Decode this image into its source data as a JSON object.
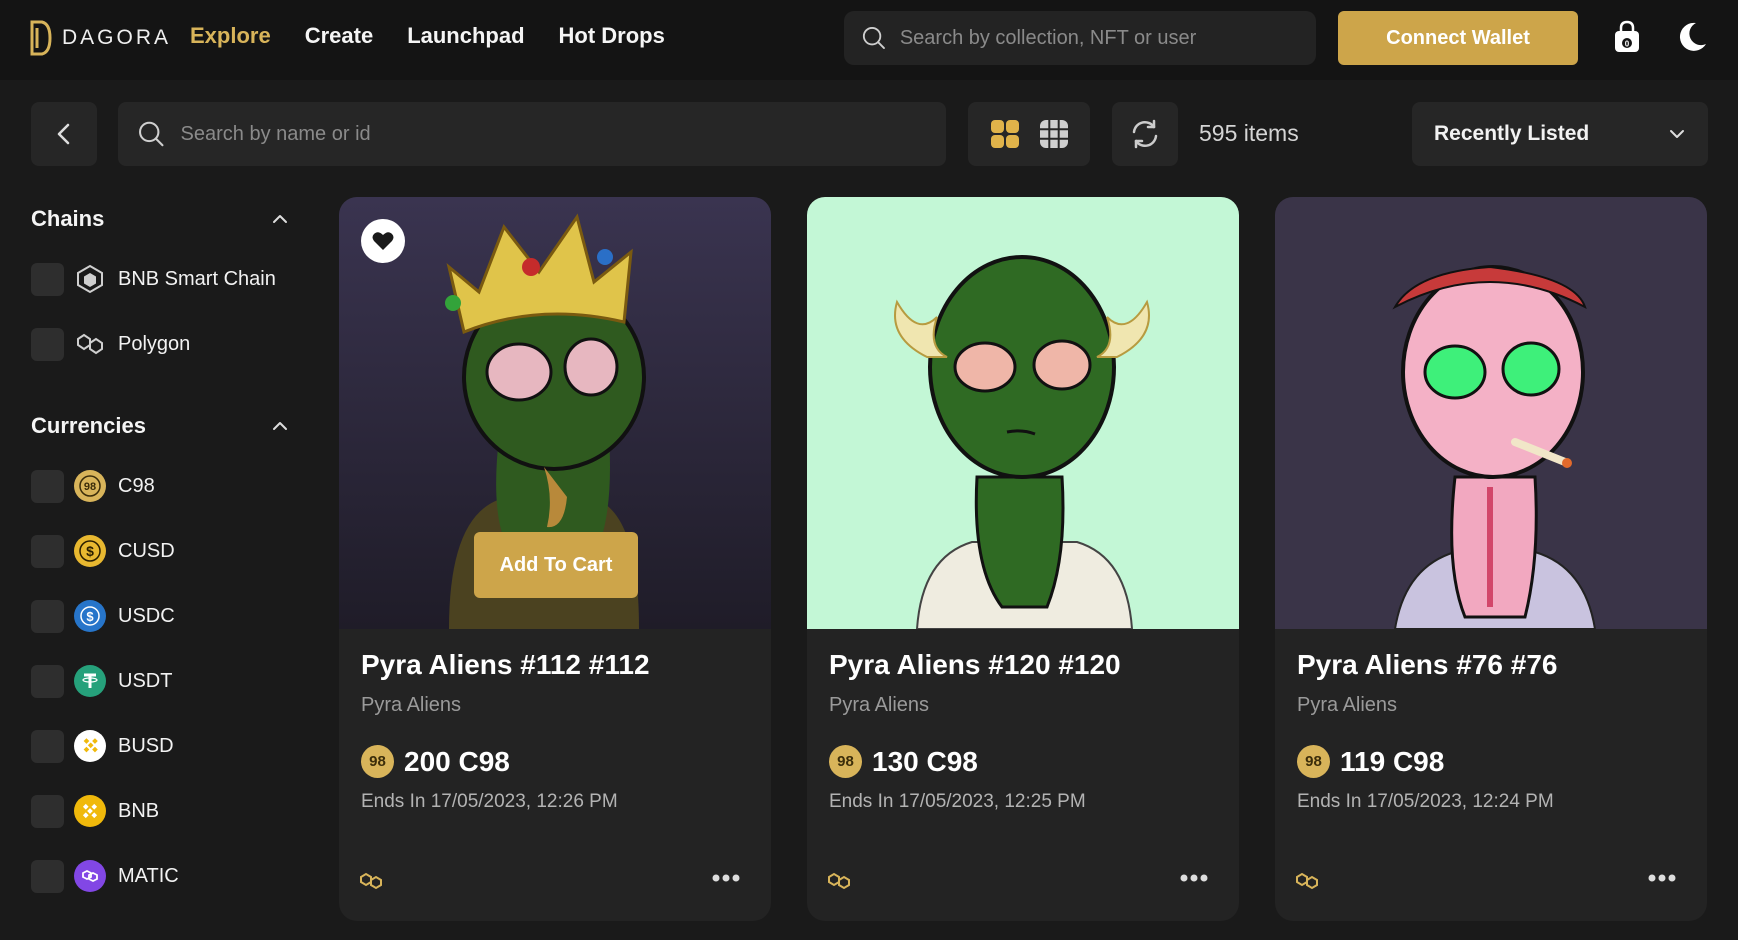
{
  "header": {
    "logo_text": "DAGORA",
    "nav": [
      {
        "label": "Explore",
        "active": true
      },
      {
        "label": "Create",
        "active": false
      },
      {
        "label": "Launchpad",
        "active": false
      },
      {
        "label": "Hot Drops",
        "active": false
      }
    ],
    "search_placeholder": "Search by collection, NFT or user",
    "connect_label": "Connect Wallet",
    "icons": [
      "shopping-bag-icon",
      "moon-icon"
    ]
  },
  "toolbar": {
    "search_placeholder": "Search by name or id",
    "items_count": "595 items",
    "sort_label": "Recently Listed"
  },
  "sidebar": {
    "chains_title": "Chains",
    "chains": [
      {
        "label": "BNB Smart Chain",
        "icon": "bnb-chain-icon"
      },
      {
        "label": "Polygon",
        "icon": "polygon-icon"
      }
    ],
    "currencies_title": "Currencies",
    "currencies": [
      {
        "label": "C98",
        "icon": "c98-icon",
        "color": "#d8b45a"
      },
      {
        "label": "CUSD",
        "icon": "cusd-icon",
        "color": "#e8b830"
      },
      {
        "label": "USDC",
        "icon": "usdc-icon",
        "color": "#2775ca"
      },
      {
        "label": "USDT",
        "icon": "usdt-icon",
        "color": "#26a17b"
      },
      {
        "label": "BUSD",
        "icon": "busd-icon",
        "color": "#f0b90b"
      },
      {
        "label": "BNB",
        "icon": "bnb-icon",
        "color": "#f0b90b"
      },
      {
        "label": "MATIC",
        "icon": "matic-icon",
        "color": "#8247e5"
      }
    ]
  },
  "cards": [
    {
      "title": "Pyra Aliens #112 #112",
      "collection": "Pyra Aliens",
      "price": "200 C98",
      "coin": "98",
      "ends": "Ends In 17/05/2023, 12:26 PM",
      "add_to_cart": "Add To Cart",
      "bg": "#2f2a3d"
    },
    {
      "title": "Pyra Aliens #120 #120",
      "collection": "Pyra Aliens",
      "price": "130 C98",
      "coin": "98",
      "ends": "Ends In 17/05/2023, 12:25 PM",
      "bg": "#c3f7d6"
    },
    {
      "title": "Pyra Aliens #76 #76",
      "collection": "Pyra Aliens",
      "price": "119 C98",
      "coin": "98",
      "ends": "Ends In 17/05/2023, 12:24 PM",
      "bg": "#3a3448"
    }
  ],
  "colors": {
    "accent": "#cda54a",
    "background": "#1a1a1a",
    "panel": "#262626"
  }
}
